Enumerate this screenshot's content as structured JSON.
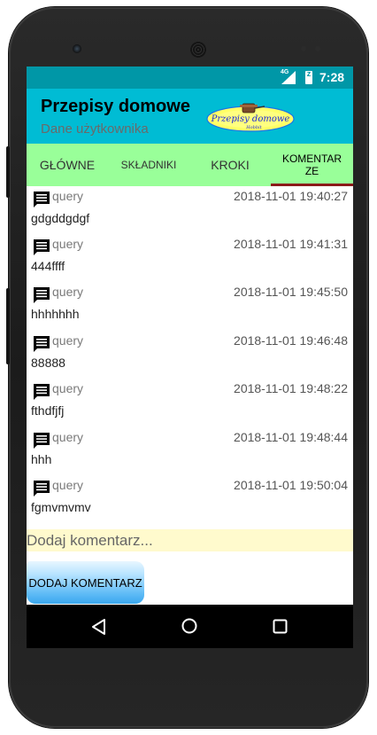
{
  "status_bar": {
    "network": "4G",
    "battery": "z",
    "time": "7:28"
  },
  "app_bar": {
    "title": "Przepisy domowe",
    "subtitle": "Dane użytkownika",
    "logo_text": "Przepisy domowe",
    "logo_subtext": "Hobbit"
  },
  "tabs": [
    {
      "label": "GŁÓWNE"
    },
    {
      "label": "SKŁADNIKI"
    },
    {
      "label": "KROKI"
    },
    {
      "label": "KOMENTAR\nZE"
    }
  ],
  "comments": [
    {
      "user": "query",
      "timestamp": "2018-11-01 19:40:27",
      "text": "gdgddgdgf"
    },
    {
      "user": "query",
      "timestamp": "2018-11-01 19:41:31",
      "text": "444ffff"
    },
    {
      "user": "query",
      "timestamp": "2018-11-01 19:45:50",
      "text": "hhhhhhh"
    },
    {
      "user": "query",
      "timestamp": "2018-11-01 19:46:48",
      "text": "88888"
    },
    {
      "user": "query",
      "timestamp": "2018-11-01 19:48:22",
      "text": "fthdfjfj"
    },
    {
      "user": "query",
      "timestamp": "2018-11-01 19:48:44",
      "text": "hhh"
    },
    {
      "user": "query",
      "timestamp": "2018-11-01 19:50:04",
      "text": "fgmvmvmv"
    }
  ],
  "comment_input": {
    "placeholder": "Dodaj komentarz...",
    "value": ""
  },
  "add_button": {
    "label": "DODAJ KOMENTARZ"
  },
  "icons": {
    "comment": "comment-icon",
    "back": "back-icon",
    "home": "home-icon",
    "recent": "recent-apps-icon"
  },
  "colors": {
    "status_bar": "#0097a7",
    "app_bar": "#00bcd4",
    "tab_bar": "#99ff99",
    "tab_indicator": "#8b1a1a",
    "input_bg": "#fffacd",
    "button": "#59b8f5"
  }
}
